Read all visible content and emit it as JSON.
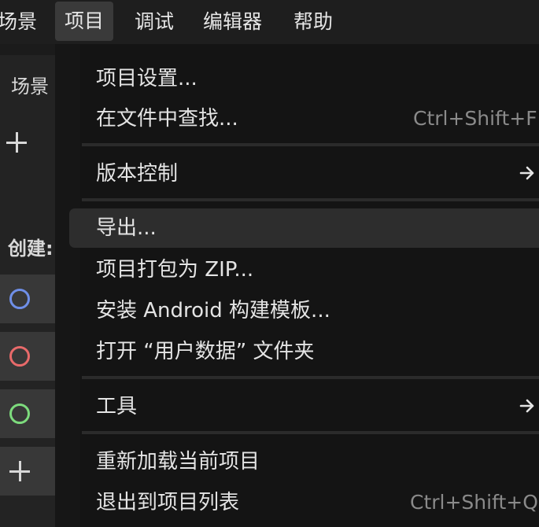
{
  "menubar": {
    "items": [
      "场景",
      "项目",
      "调试",
      "编辑器",
      "帮助"
    ]
  },
  "left_panel": {
    "scene_tab": "场景",
    "create_label": "创建:",
    "node_colors": [
      "#6f8fe8",
      "#e86a6a",
      "#7ddb7d"
    ]
  },
  "menu": {
    "project_settings": "项目设置...",
    "find_in_files": "在文件中查找...",
    "find_in_files_shortcut": "Ctrl+Shift+F",
    "version_control": "版本控制",
    "export": "导出...",
    "pack_zip": "项目打包为 ZIP...",
    "install_android": "安装 Android 构建模板...",
    "open_user_data": "打开 “用户数据” 文件夹",
    "tools": "工具",
    "reload_project": "重新加载当前项目",
    "quit_to_list": "退出到项目列表",
    "quit_to_list_shortcut": "Ctrl+Shift+Q"
  }
}
